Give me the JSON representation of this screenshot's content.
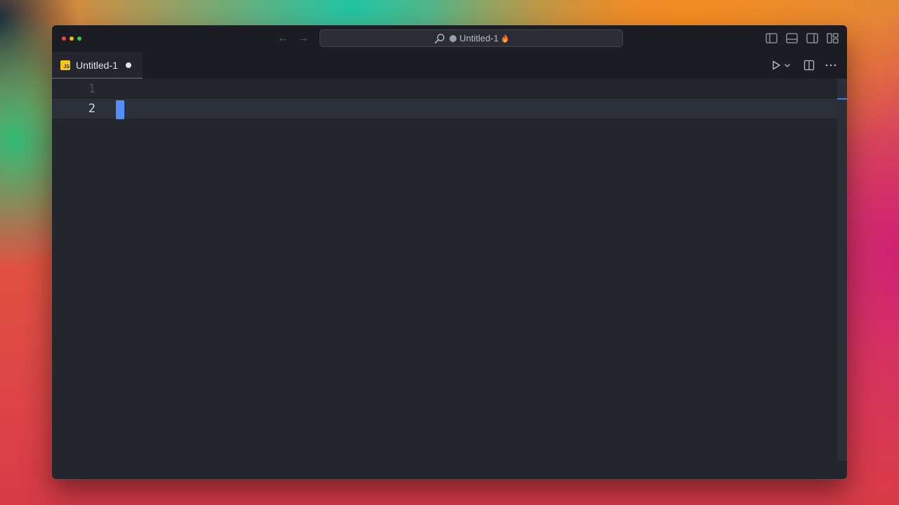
{
  "window": {
    "traffic_lights": [
      "close",
      "minimize",
      "zoom"
    ],
    "command_center": {
      "title": "Untitled-1",
      "icons": [
        "search-icon",
        "dirty-indicator",
        "fire-icon"
      ]
    },
    "layout_icons": [
      "toggle-primary-sidebar-icon",
      "toggle-panel-icon",
      "toggle-secondary-sidebar-icon",
      "customize-layout-icon"
    ]
  },
  "tabs": [
    {
      "label": "Untitled-1",
      "language_badge": "JS",
      "dirty": true,
      "active": true
    }
  ],
  "tab_actions": [
    "run-icon",
    "chevron-down-icon",
    "split-editor-icon",
    "more-actions-icon"
  ],
  "editor": {
    "lines": [
      {
        "number": "1",
        "text": ""
      },
      {
        "number": "2",
        "text": ""
      }
    ],
    "current_line": 2
  },
  "colors": {
    "cursor": "#4f8ff7",
    "js_badge": "#f5c518",
    "editor_bg": "#23262d"
  }
}
